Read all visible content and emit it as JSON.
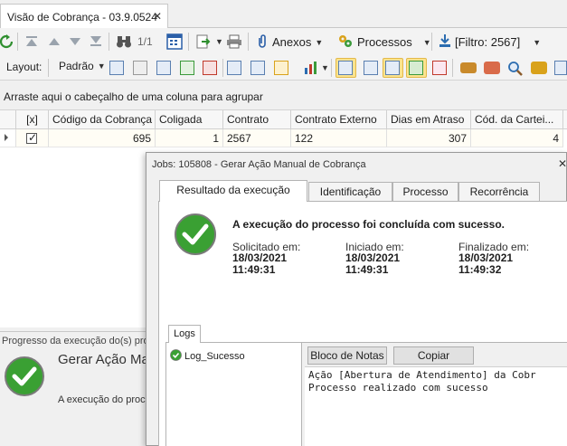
{
  "window": {
    "tab_title": "Visão de Cobrança - 03.9.0524",
    "close_glyph": "✕"
  },
  "toolbar1": {
    "page_indicator": "1/1",
    "anexos_label": "Anexos",
    "processos_label": "Processos",
    "filter_label": "[Filtro: 2567]"
  },
  "toolbar2": {
    "layout_label": "Layout:",
    "layout_value": "Padrão"
  },
  "groupbar": {
    "hint": "Arraste aqui o cabeçalho de uma coluna para agrupar"
  },
  "grid": {
    "columns": [
      "[x]",
      "Código da Cobrança",
      "Coligada",
      "Contrato",
      "Contrato Externo",
      "Dias em Atraso",
      "Cód. da Cartei..."
    ],
    "row": {
      "checked": true,
      "codigo": "695",
      "coligada": "1",
      "contrato": "2567",
      "contrato_externo": "122",
      "dias_atraso": "307",
      "cod_carteira": "4"
    }
  },
  "progress": {
    "caption": "Progresso da execução do(s) pro",
    "title": "Gerar Ação Ma",
    "message": "A execução do proc"
  },
  "dialog": {
    "title": "Jobs: 105808 - Gerar Ação Manual de Cobrança",
    "tabs": [
      "Resultado da execução",
      "Identificação",
      "Processo",
      "Recorrência"
    ],
    "headline": "A execução do processo foi concluída com sucesso.",
    "solicitado": {
      "label": "Solicitado em:",
      "date": "18/03/2021",
      "time": "11:49:31"
    },
    "iniciado": {
      "label": "Iniciado em:",
      "date": "18/03/2021",
      "time": "11:49:31"
    },
    "finalizado": {
      "label": "Finalizado em:",
      "date": "18/03/2021",
      "time": "11:49:32"
    },
    "logs_tab": "Logs",
    "log_item": "Log_Sucesso",
    "notepad_button": "Bloco de Notas",
    "copy_button": "Copiar",
    "log_line1": "Ação [Abertura de Atendimento] da Cobr",
    "log_line2": "Processo realizado com sucesso"
  },
  "colors": {
    "success_green": "#3aa033",
    "accent_blue": "#2b6cb0",
    "highlight_yellow": "#fbe38e"
  }
}
